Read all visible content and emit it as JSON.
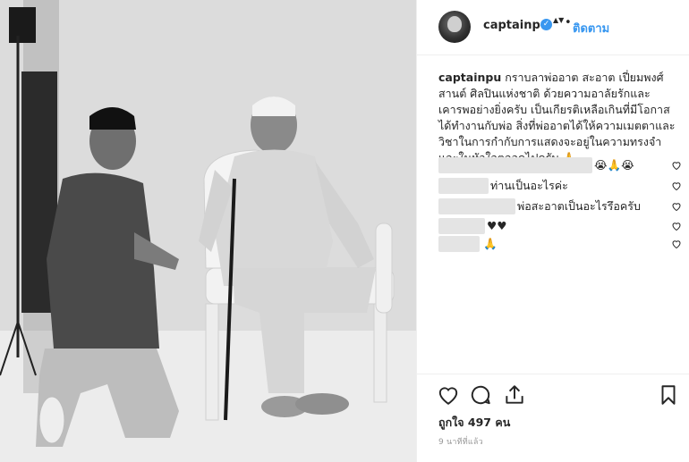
{
  "post": {
    "username": "captainpu",
    "verified_glyph": "✓",
    "dropdown_glyph": "▲▼",
    "separator": "•",
    "follow_label": "ติดตาม",
    "caption_user": "captainpu",
    "caption_text": "กราบลาพ่ออาต สะอาต เปี่ยมพงศ์สานต์ ศิลปินแห่งชาติ ด้วยความอาลัยรักและเคารพอย่างยิ่งครับ เป็นเกียรติเหลือเกินที่มีโอกาสได้ทำงานกับพ่อ สิ่งที่พ่ออาตได้ให้ความเมตตาและวิชาในการกำกับการแสดงจะอยู่ในความทรงจำและในหัวใจตลอดไปครับ 🙏",
    "likes": "ถูกใจ 497 คน",
    "time": "9 นาทีที่แล้ว"
  },
  "comments": [
    {
      "user": "",
      "text": "😭🙏😭"
    },
    {
      "user": "",
      "text": "ท่านเป็นอะไรค่ะ"
    },
    {
      "user": "",
      "text": "พ่อสะอาตเป็นอะไรรึอครับ"
    },
    {
      "user": "",
      "text": "♥♥"
    },
    {
      "user": "",
      "text": "🙏"
    }
  ],
  "icons": {
    "like": "heart-icon",
    "comment": "comment-icon",
    "share": "share-icon",
    "save": "bookmark-icon"
  }
}
